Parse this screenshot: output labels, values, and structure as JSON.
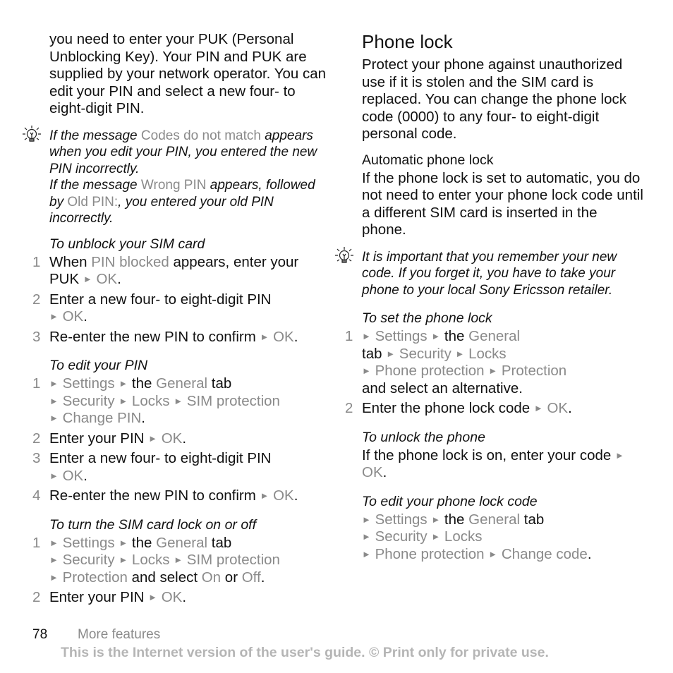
{
  "left_column": {
    "intro": "you need to enter your PUK (Personal Unblocking Key). Your PIN and PUK are supplied by your network operator. You can edit your PIN and select a new four- to eight-digit PIN.",
    "tip": {
      "icon": "lightbulb-icon",
      "p1_a": "If the message ",
      "p1_hl": "Codes do not match",
      "p1_b": " appears when you edit your PIN, you entered the new PIN incorrectly.",
      "p2_a": "If the message ",
      "p2_hl1": "Wrong PIN",
      "p2_b": " appears, followed by ",
      "p2_hl2": "Old PIN:",
      "p2_c": ", you entered your old PIN incorrectly."
    },
    "unblock": {
      "title": "To unblock your SIM card",
      "s1_num": "1",
      "s1_a": "When ",
      "s1_hl": "PIN blocked",
      "s1_b": " appears, enter your PUK ",
      "s1_ok": "OK",
      "s2_num": "2",
      "s2_a": "Enter a new four- to eight-digit PIN ",
      "s2_ok": "OK",
      "s3_num": "3",
      "s3_a": "Re-enter the new PIN to confirm ",
      "s3_ok": "OK"
    },
    "edit_pin": {
      "title": "To edit your PIN",
      "s1_num": "1",
      "settings": "Settings",
      "the": " the ",
      "general": "General",
      "tab": " tab",
      "security": "Security",
      "locks": "Locks",
      "sim_protection": "SIM protection",
      "change_pin": "Change PIN",
      "s2_num": "2",
      "s2_a": "Enter your PIN ",
      "s2_ok": "OK",
      "s3_num": "3",
      "s3_a": "Enter a new four- to eight-digit PIN ",
      "s3_ok": "OK",
      "s4_num": "4",
      "s4_a": "Re-enter the new PIN to confirm ",
      "s4_ok": "OK"
    },
    "sim_lock": {
      "title": "To turn the SIM card lock on or off",
      "s1_num": "1",
      "settings": "Settings",
      "the": " the ",
      "general": "General",
      "tab": " tab",
      "security": "Security",
      "locks": "Locks",
      "sim_protection": "SIM protection",
      "protection": "Protection",
      "and_select": " and select ",
      "on": "On",
      "or": " or ",
      "off": "Off",
      "s2_num": "2",
      "s2_a": "Enter your PIN ",
      "s2_ok": "OK"
    }
  },
  "right_column": {
    "heading": "Phone lock",
    "intro": "Protect your phone against unauthorized use if it is stolen and the SIM card is replaced. You can change the phone lock code (0000) to any four- to eight-digit personal code.",
    "auto_heading": "Automatic phone lock",
    "auto_text": "If the phone lock is set to automatic, you do not need to enter your phone lock code until a different SIM card is inserted in the phone.",
    "tip": {
      "icon": "lightbulb-icon",
      "text": "It is important that you remember your new code. If you forget it, you have to take your phone to your local Sony Ericsson retailer."
    },
    "set_lock": {
      "title": "To set the phone lock",
      "s1_num": "1",
      "settings": "Settings",
      "the": " the ",
      "general": "General",
      "tab": "tab ",
      "security": "Security",
      "locks": "Locks",
      "phone_protection": "Phone protection",
      "protection": "Protection",
      "and_select": "and select an alternative.",
      "s2_num": "2",
      "s2_a": "Enter the phone lock code ",
      "s2_ok": "OK"
    },
    "unlock": {
      "title": "To unlock the phone",
      "text": "If the phone lock is on, enter your code ",
      "ok": "OK"
    },
    "edit_code": {
      "title": "To edit your phone lock code",
      "settings": "Settings",
      "the": " the ",
      "general": "General",
      "tab": " tab",
      "security": "Security",
      "locks": "Locks",
      "phone_protection": "Phone protection",
      "change_code": "Change code"
    }
  },
  "footer": {
    "page_number": "78",
    "section": "More features",
    "note": "This is the Internet version of the user's guide. © Print only for private use."
  },
  "colors": {
    "text": "#111111",
    "highlight": "#8a8a8a",
    "footer_note": "#b5b5b5"
  },
  "arrow_glyph": "►",
  "period": "."
}
